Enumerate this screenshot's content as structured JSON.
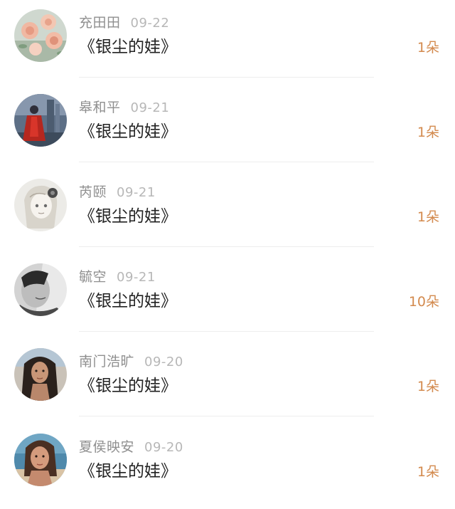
{
  "rows": [
    {
      "username": "充田田",
      "date": "09-22",
      "book": "《银尘的娃》",
      "count": "1朵",
      "avatar": "peach-roses-avatar-icon"
    },
    {
      "username": "皋和平",
      "date": "09-21",
      "book": "《银尘的娃》",
      "count": "1朵",
      "avatar": "red-robed-figure-avatar-icon"
    },
    {
      "username": "芮颐",
      "date": "09-21",
      "book": "《银尘的娃》",
      "count": "1朵",
      "avatar": "anime-girl-sketch-avatar-icon"
    },
    {
      "username": "毓空",
      "date": "09-21",
      "book": "《银尘的娃》",
      "count": "10朵",
      "avatar": "grayscale-face-avatar-icon"
    },
    {
      "username": "南门浩旷",
      "date": "09-20",
      "book": "《银尘的娃》",
      "count": "1朵",
      "avatar": "dark-hair-woman-avatar-icon"
    },
    {
      "username": "夏侯映安",
      "date": "09-20",
      "book": "《银尘的娃》",
      "count": "1朵",
      "avatar": "beach-woman-avatar-icon"
    }
  ],
  "colors": {
    "username": "#8f8f8f",
    "date": "#b7b7b7",
    "book": "#222222",
    "count": "#d38a4e",
    "divider": "#ededed"
  }
}
